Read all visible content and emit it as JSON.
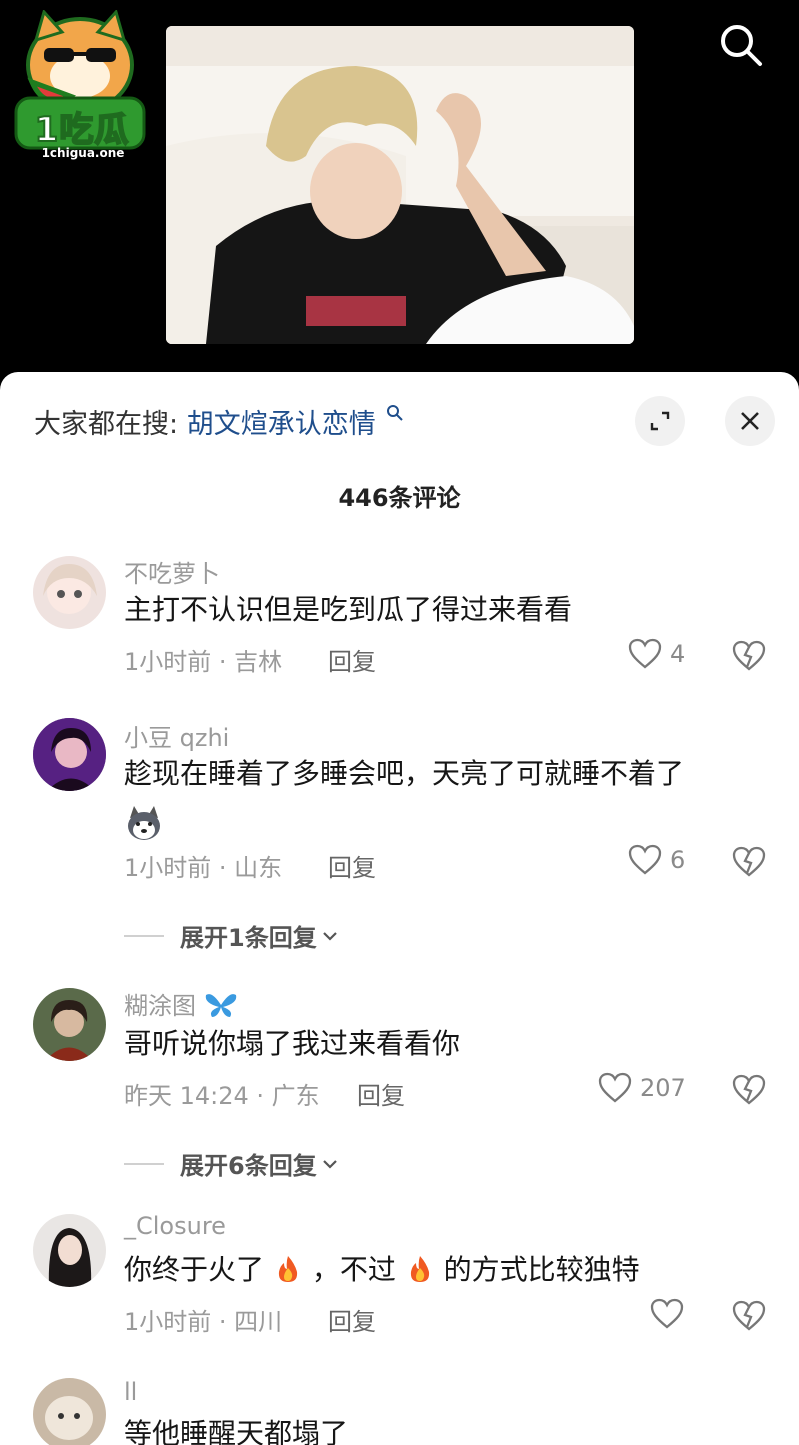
{
  "logo": {
    "main": "1吃瓜",
    "sub": "1chigua.one"
  },
  "hot_search": {
    "prefix": "大家都在搜:",
    "term": "胡文煊承认恋情"
  },
  "comment_count": "446条评论",
  "comments": [
    {
      "username": "不吃萝卜",
      "text": "主打不认识但是吃到瓜了得过来看看",
      "meta": "1小时前 · 吉林",
      "reply": "回复",
      "likes": "4"
    },
    {
      "username": "小豆 qzhi",
      "text": "趁现在睡着了多睡会吧，天亮了可就睡不着了",
      "meta": "1小时前 · 山东",
      "reply": "回复",
      "likes": "6",
      "expand": "展开1条回复"
    },
    {
      "username": "糊涂图",
      "text": "哥听说你塌了我过来看看你",
      "meta": "昨天 14:24 · 广东",
      "reply": "回复",
      "likes": "207",
      "expand": "展开6条回复"
    },
    {
      "username": "_Closure",
      "text_a": "你终于火了",
      "text_b": "，不过",
      "text_c": "的方式比较独特",
      "meta": "1小时前 · 四川",
      "reply": "回复",
      "likes": ""
    },
    {
      "username": "ll",
      "text": "等他睡醒天都塌了"
    }
  ],
  "colors": {
    "sheet_bg": "#ffffff",
    "link": "#1f4e8c",
    "muted": "#9a9a9a"
  }
}
